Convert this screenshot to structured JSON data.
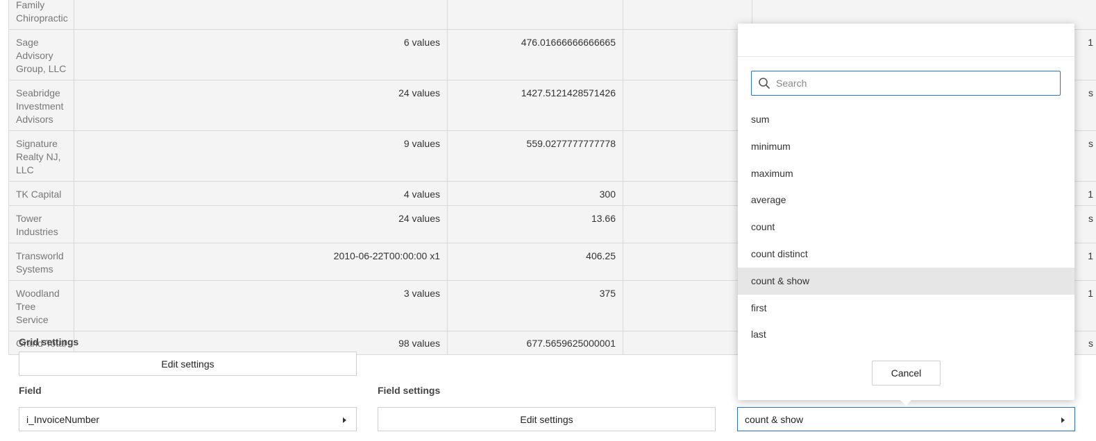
{
  "grid": {
    "rows": [
      {
        "name": "Family Chiropractic",
        "values": "",
        "avg": "",
        "clip": ""
      },
      {
        "name": "Sage Advisory Group, LLC",
        "values": "6 values",
        "avg": "476.01666666666665",
        "clip": "1"
      },
      {
        "name": "Seabridge Investment Advisors",
        "values": "24 values",
        "avg": "1427.5121428571426",
        "clip": "s"
      },
      {
        "name": "Signature Realty NJ, LLC",
        "values": "9 values",
        "avg": "559.0277777777778",
        "clip": "s"
      },
      {
        "name": "TK Capital",
        "values": "4 values",
        "avg": "300",
        "clip": "1"
      },
      {
        "name": "Tower Industries",
        "values": "24 values",
        "avg": "13.66",
        "clip": "s"
      },
      {
        "name": "Transworld Systems",
        "values": "2010-06-22T00:00:00 x1",
        "avg": "406.25",
        "clip": "1"
      },
      {
        "name": "Woodland Tree Service",
        "values": "3 values",
        "avg": "375",
        "clip": "1"
      },
      {
        "name": "Grand Total",
        "values": "98 values",
        "avg": "677.5659625000001",
        "clip": "s"
      }
    ]
  },
  "grid_settings": {
    "label": "Grid settings",
    "edit_button": "Edit settings"
  },
  "field": {
    "label": "Field",
    "value": "i_InvoiceNumber"
  },
  "field_settings": {
    "label": "Field settings",
    "edit_button": "Edit settings"
  },
  "aggregator": {
    "value": "count & show"
  },
  "popup": {
    "search_placeholder": "Search",
    "options": [
      "sum",
      "minimum",
      "maximum",
      "average",
      "count",
      "count distinct",
      "count & show",
      "first",
      "last"
    ],
    "selected": "count & show",
    "cancel": "Cancel"
  }
}
